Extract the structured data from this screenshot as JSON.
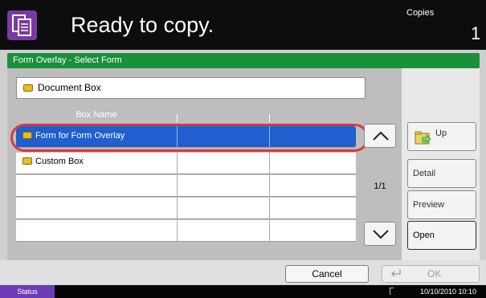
{
  "header": {
    "title": "Ready to copy.",
    "copies_label": "Copies",
    "copies_value": "1"
  },
  "breadcrumb": "Form Overlay - Select Form",
  "path": {
    "folder_icon": "folder-icon",
    "label": "Document Box"
  },
  "list": {
    "column_header": "Box Name",
    "rows": [
      {
        "name": "Form for Form Overlay",
        "selected": true
      },
      {
        "name": "Custom Box",
        "selected": false
      },
      {
        "name": "",
        "selected": false
      },
      {
        "name": "",
        "selected": false
      },
      {
        "name": "",
        "selected": false
      }
    ],
    "page_indicator": "1/1"
  },
  "side_buttons": {
    "up_label": "Up",
    "detail_label": "Detail",
    "preview_label": "Preview",
    "open_label": "Open"
  },
  "footer": {
    "cancel_label": "Cancel",
    "ok_label": "OK"
  },
  "status": {
    "status_label": "Status",
    "datetime": "10/10/2010 10:10"
  },
  "colors": {
    "header_bg": "#0d0d0f",
    "crumb_bg": "#1b8f3a",
    "selection": "#1f5fcf",
    "highlight_ring": "#d83a40",
    "status_button": "#6c3bb5"
  }
}
